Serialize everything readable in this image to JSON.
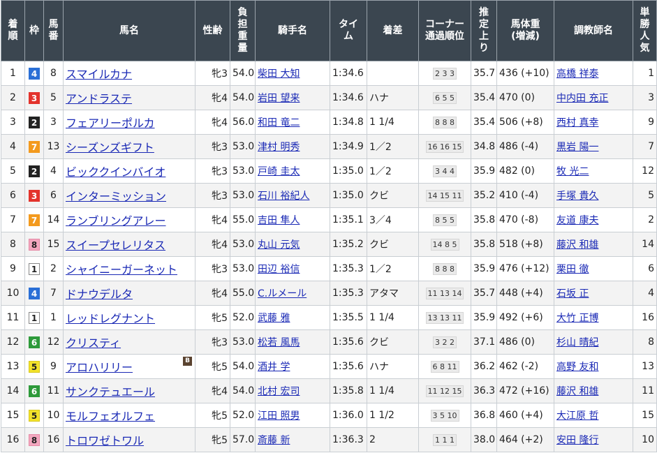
{
  "headers": [
    "着\n順",
    "枠",
    "馬\n番",
    "馬名",
    "性齢",
    "負\n担\n重\n量",
    "騎手名",
    "タイ\nム",
    "着差",
    "コーナー\n通過順位",
    "推\n定\n上\nり",
    "馬体重\n(増減)",
    "調教師名",
    "単\n勝\n人\n気"
  ],
  "blinker_label": "B",
  "rows": [
    {
      "rank": "1",
      "waku": "4",
      "umaban": "8",
      "horse": "スマイルカナ",
      "sex_age": "牝3",
      "weight": "54.0",
      "jockey": "柴田 大知",
      "time": "1:34.6",
      "margin": "",
      "corner": "2 3 3",
      "agari": "35.7",
      "body": "436 (+10)",
      "trainer": "高橋 祥泰",
      "pop": "1",
      "blinker": false
    },
    {
      "rank": "2",
      "waku": "3",
      "umaban": "5",
      "horse": "アンドラステ",
      "sex_age": "牝4",
      "weight": "54.0",
      "jockey": "岩田 望来",
      "time": "1:34.6",
      "margin": "ハナ",
      "corner": "6 5 5",
      "agari": "35.4",
      "body": "470 (0)",
      "trainer": "中内田 充正",
      "pop": "3",
      "blinker": false
    },
    {
      "rank": "3",
      "waku": "2",
      "umaban": "3",
      "horse": "フェアリーポルカ",
      "sex_age": "牝4",
      "weight": "56.0",
      "jockey": "和田 竜二",
      "time": "1:34.8",
      "margin": "1 1/4",
      "corner": "8 8 8",
      "agari": "35.4",
      "body": "506 (+8)",
      "trainer": "西村 真幸",
      "pop": "9",
      "blinker": false
    },
    {
      "rank": "4",
      "waku": "7",
      "umaban": "13",
      "horse": "シーズンズギフト",
      "sex_age": "牝3",
      "weight": "53.0",
      "jockey": "津村 明秀",
      "time": "1:34.9",
      "margin": "1／2",
      "corner": "16 16 15",
      "agari": "34.8",
      "body": "486 (-4)",
      "trainer": "黒岩 陽一",
      "pop": "7",
      "blinker": false
    },
    {
      "rank": "5",
      "waku": "2",
      "umaban": "4",
      "horse": "ビッククインバイオ",
      "sex_age": "牝3",
      "weight": "53.0",
      "jockey": "戸崎 圭太",
      "time": "1:35.0",
      "margin": "1／2",
      "corner": "3 4 4",
      "agari": "35.9",
      "body": "482 (0)",
      "trainer": "牧 光二",
      "pop": "12",
      "blinker": false
    },
    {
      "rank": "6",
      "waku": "3",
      "umaban": "6",
      "horse": "インターミッション",
      "sex_age": "牝3",
      "weight": "53.0",
      "jockey": "石川 裕紀人",
      "time": "1:35.0",
      "margin": "クビ",
      "corner": "14 15 11",
      "agari": "35.2",
      "body": "410 (-4)",
      "trainer": "手塚 貴久",
      "pop": "5",
      "blinker": false
    },
    {
      "rank": "7",
      "waku": "7",
      "umaban": "14",
      "horse": "ランブリングアレー",
      "sex_age": "牝4",
      "weight": "55.0",
      "jockey": "吉田 隼人",
      "time": "1:35.1",
      "margin": "3／4",
      "corner": "8 5 5",
      "agari": "35.8",
      "body": "470 (-8)",
      "trainer": "友道 康夫",
      "pop": "2",
      "blinker": false
    },
    {
      "rank": "8",
      "waku": "8",
      "umaban": "15",
      "horse": "スイープセレリタス",
      "sex_age": "牝4",
      "weight": "53.0",
      "jockey": "丸山 元気",
      "time": "1:35.2",
      "margin": "クビ",
      "corner": "14 8 5",
      "agari": "35.8",
      "body": "518 (+8)",
      "trainer": "藤沢 和雄",
      "pop": "14",
      "blinker": false
    },
    {
      "rank": "9",
      "waku": "1",
      "umaban": "2",
      "horse": "シャイニーガーネット",
      "sex_age": "牝3",
      "weight": "53.0",
      "jockey": "田辺 裕信",
      "time": "1:35.3",
      "margin": "1／2",
      "corner": "8 8 8",
      "agari": "35.9",
      "body": "476 (+12)",
      "trainer": "栗田 徹",
      "pop": "6",
      "blinker": false
    },
    {
      "rank": "10",
      "waku": "4",
      "umaban": "7",
      "horse": "ドナウデルタ",
      "sex_age": "牝4",
      "weight": "55.0",
      "jockey": "C.ルメール",
      "time": "1:35.3",
      "margin": "アタマ",
      "corner": "11 13 14",
      "agari": "35.7",
      "body": "448 (+4)",
      "trainer": "石坂 正",
      "pop": "4",
      "blinker": false
    },
    {
      "rank": "11",
      "waku": "1",
      "umaban": "1",
      "horse": "レッドレグナント",
      "sex_age": "牝5",
      "weight": "52.0",
      "jockey": "武藤 雅",
      "time": "1:35.5",
      "margin": "1 1/4",
      "corner": "13 13 11",
      "agari": "35.9",
      "body": "492 (+6)",
      "trainer": "大竹 正博",
      "pop": "16",
      "blinker": false
    },
    {
      "rank": "12",
      "waku": "6",
      "umaban": "12",
      "horse": "クリスティ",
      "sex_age": "牝3",
      "weight": "53.0",
      "jockey": "松若 風馬",
      "time": "1:35.6",
      "margin": "クビ",
      "corner": "3 2 2",
      "agari": "37.1",
      "body": "486 (0)",
      "trainer": "杉山 晴紀",
      "pop": "8",
      "blinker": false
    },
    {
      "rank": "13",
      "waku": "5",
      "umaban": "9",
      "horse": "アロハリリー",
      "sex_age": "牝5",
      "weight": "54.0",
      "jockey": "酒井 学",
      "time": "1:35.6",
      "margin": "ハナ",
      "corner": "6 8 11",
      "agari": "36.2",
      "body": "462 (-2)",
      "trainer": "高野 友和",
      "pop": "13",
      "blinker": true
    },
    {
      "rank": "14",
      "waku": "6",
      "umaban": "11",
      "horse": "サンクテュエール",
      "sex_age": "牝4",
      "weight": "54.0",
      "jockey": "北村 宏司",
      "time": "1:35.8",
      "margin": "1 1/4",
      "corner": "11 12 15",
      "agari": "36.3",
      "body": "472 (+16)",
      "trainer": "藤沢 和雄",
      "pop": "11",
      "blinker": false
    },
    {
      "rank": "15",
      "waku": "5",
      "umaban": "10",
      "horse": "モルフェオルフェ",
      "sex_age": "牝5",
      "weight": "52.0",
      "jockey": "江田 照男",
      "time": "1:36.0",
      "margin": "1 1/2",
      "corner": "3 5 10",
      "agari": "36.8",
      "body": "460 (+4)",
      "trainer": "大江原 哲",
      "pop": "15",
      "blinker": false
    },
    {
      "rank": "16",
      "waku": "8",
      "umaban": "16",
      "horse": "トロワゼトワル",
      "sex_age": "牝5",
      "weight": "57.0",
      "jockey": "斎藤 新",
      "time": "1:36.3",
      "margin": "2",
      "corner": "1 1 1",
      "agari": "38.0",
      "body": "464 (+2)",
      "trainer": "安田 隆行",
      "pop": "10",
      "blinker": false
    }
  ],
  "waku_colors": {
    "1": {
      "bg": "#ffffff",
      "fg": "#222222",
      "border": "#888888"
    },
    "2": {
      "bg": "#222222",
      "fg": "#ffffff",
      "border": "#222222"
    },
    "3": {
      "bg": "#e3332c",
      "fg": "#ffffff",
      "border": "#e3332c"
    },
    "4": {
      "bg": "#2a6fd6",
      "fg": "#ffffff",
      "border": "#2a6fd6"
    },
    "5": {
      "bg": "#f2e22a",
      "fg": "#222222",
      "border": "#d8c81e"
    },
    "6": {
      "bg": "#2e9a3a",
      "fg": "#ffffff",
      "border": "#2e9a3a"
    },
    "7": {
      "bg": "#f39a1e",
      "fg": "#ffffff",
      "border": "#f39a1e"
    },
    "8": {
      "bg": "#f3a7bf",
      "fg": "#222222",
      "border": "#e58aa6"
    }
  }
}
